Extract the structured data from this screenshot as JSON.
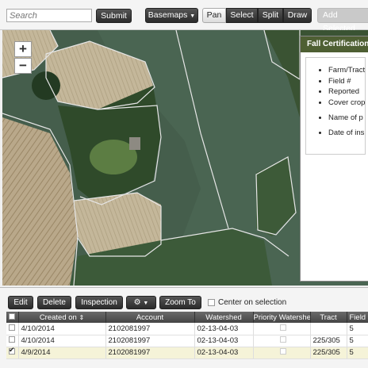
{
  "toolbar": {
    "search_placeholder": "Search",
    "submit_label": "Submit",
    "basemaps_label": "Basemaps",
    "modes": [
      "Pan",
      "Select",
      "Split",
      "Draw"
    ],
    "add_selected_label": "Add Selected"
  },
  "map": {
    "zoom_in": "+",
    "zoom_out": "−"
  },
  "panel": {
    "title": "Fall Certification Form",
    "items": [
      "Farm/Tract",
      "Field #",
      "Reported",
      "Cover crop",
      "Name of p",
      "Date of ins"
    ]
  },
  "grid_toolbar": {
    "edit": "Edit",
    "delete": "Delete",
    "inspection": "Inspection",
    "zoom_to": "Zoom To",
    "center_on_selection": "Center on selection"
  },
  "table": {
    "headers": [
      "Created on",
      "Account",
      "Watershed",
      "Priority Watershed",
      "Tract",
      "Field"
    ],
    "rows": [
      {
        "created": "4/10/2014",
        "account": "2102081997",
        "watershed": "02-13-04-03",
        "tract": "",
        "field": "5"
      },
      {
        "created": "4/10/2014",
        "account": "2102081997",
        "watershed": "02-13-04-03",
        "tract": "225/305",
        "field": "5"
      },
      {
        "created": "4/9/2014",
        "account": "2102081997",
        "watershed": "02-13-04-03",
        "tract": "225/305",
        "field": "5"
      }
    ]
  }
}
